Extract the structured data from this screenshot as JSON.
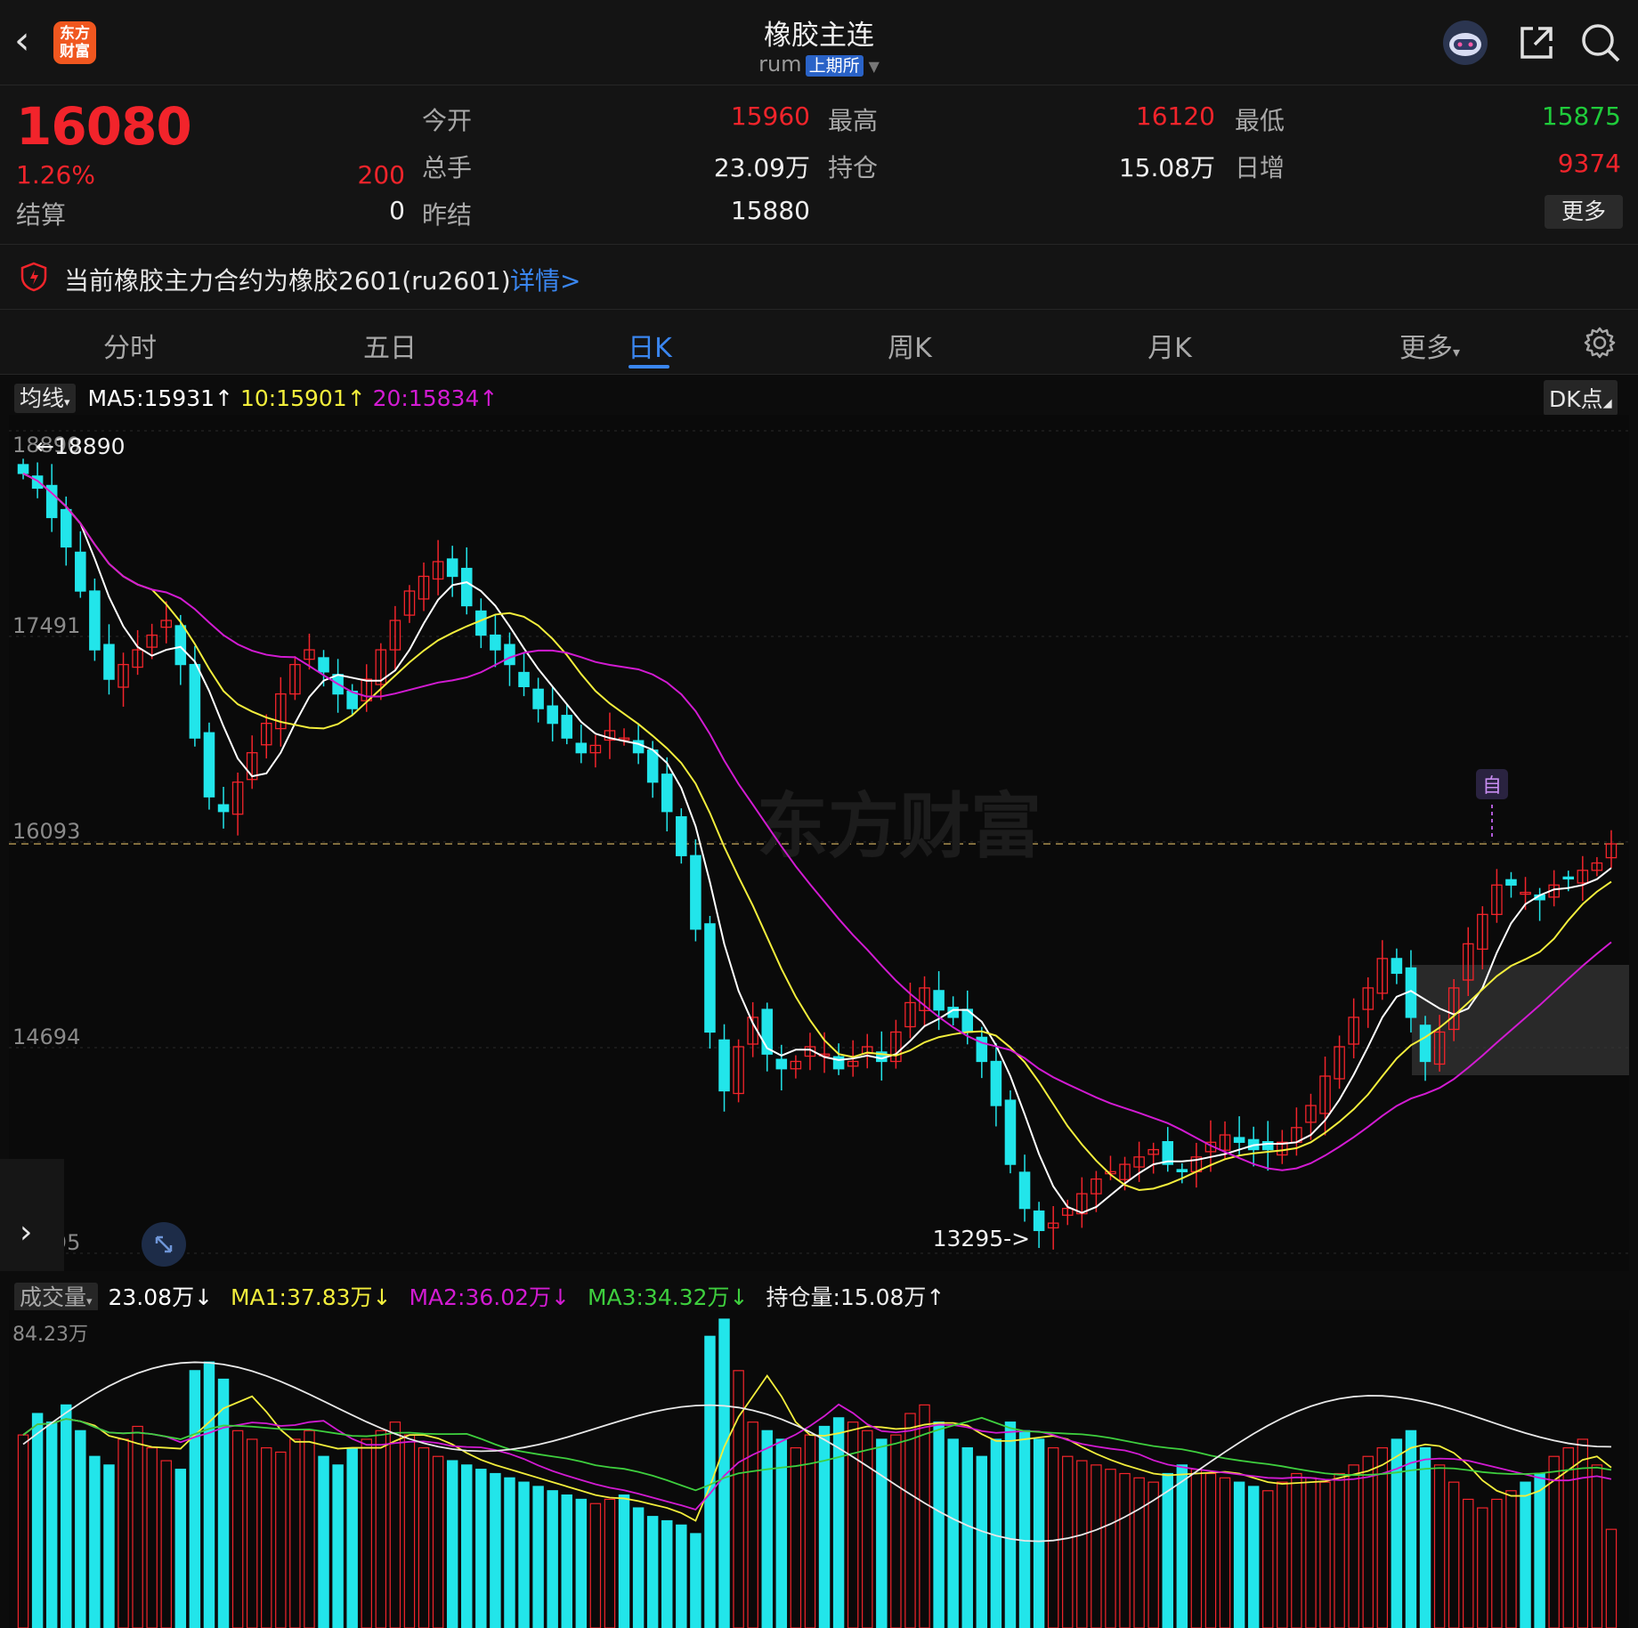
{
  "header": {
    "logo_text_1": "东方",
    "logo_text_2": "财富",
    "title": "橡胶主连",
    "code": "rum",
    "exchange": "上期所",
    "icons": [
      "back-icon",
      "robot-icon",
      "share-icon",
      "search-icon"
    ]
  },
  "quote": {
    "last": "16080",
    "change_pct": "1.26%",
    "change": "200",
    "open_label": "今开",
    "open": "15960",
    "high_label": "最高",
    "high": "16120",
    "low_label": "最低",
    "low": "15875",
    "volume_label": "总手",
    "volume": "23.09万",
    "oi_label": "持仓",
    "oi": "15.08万",
    "daily_add_label": "日增",
    "daily_add": "9374",
    "settle_label": "结算",
    "settle": "0",
    "prev_settle_label": "昨结",
    "prev_settle": "15880",
    "more_label": "更多"
  },
  "notice": {
    "text": "当前橡胶主力合约为橡胶2601(ru2601)",
    "link": "详情>"
  },
  "tabs": [
    {
      "label": "分时"
    },
    {
      "label": "五日"
    },
    {
      "label": "日K"
    },
    {
      "label": "周K"
    },
    {
      "label": "月K"
    },
    {
      "label": "更多"
    }
  ],
  "indicators": {
    "ma_selector": "均线",
    "ma5": "MA5:15931↑",
    "ma10": "10:15901↑",
    "ma20": "20:15834↑",
    "dk": "DK点",
    "vol_selector": "成交量",
    "vol": "23.08万↓",
    "vol_ma1": "MA1:37.83万↓",
    "vol_ma2": "MA2:36.02万↓",
    "vol_ma3": "MA3:34.32万↓",
    "oi": "持仓量:15.08万↑"
  },
  "colors": {
    "up": "#f2242b",
    "down": "#22e5ea",
    "ma5": "#ffffff",
    "ma10": "#f3ee3c",
    "ma20": "#d21bd2",
    "accent": "#3a86f0",
    "vol_ma3": "#3ecf3e"
  },
  "chart_data": {
    "type": "candlestick",
    "y_ticks": [
      "18890",
      "17491",
      "16093",
      "14694",
      "13295"
    ],
    "ylim": [
      13295,
      18890
    ],
    "high_label": "18890",
    "low_label": "13295->",
    "last_price": 16080,
    "marker_label": "自",
    "closes": [
      18600,
      18500,
      18300,
      18100,
      17800,
      17400,
      17200,
      17300,
      17400,
      17500,
      17600,
      17300,
      16800,
      16400,
      16300,
      16500,
      16700,
      16900,
      17100,
      17300,
      17400,
      17250,
      17100,
      17000,
      17200,
      17400,
      17600,
      17800,
      17900,
      18000,
      17900,
      17700,
      17500,
      17400,
      17300,
      17150,
      17000,
      16900,
      16800,
      16700,
      16750,
      16850,
      16800,
      16700,
      16500,
      16300,
      16000,
      15500,
      14800,
      14400,
      14700,
      14900,
      14650,
      14550,
      14600,
      14700,
      14650,
      14550,
      14600,
      14700,
      14600,
      14800,
      15000,
      15100,
      14950,
      14900,
      14800,
      14600,
      14300,
      13900,
      13600,
      13450,
      13500,
      13600,
      13700,
      13800,
      13850,
      13900,
      13950,
      14000,
      13900,
      13850,
      13950,
      14050,
      14100,
      14050,
      14000,
      14000,
      14050,
      14150,
      14300,
      14500,
      14700,
      14900,
      15100,
      15300,
      15200,
      14900,
      14600,
      14800,
      15100,
      15400,
      15600,
      15800,
      15800,
      15750,
      15700,
      15800,
      15850,
      15900,
      15950,
      16080
    ],
    "volume_axis_label": "84.23万",
    "volume": [
      45,
      50,
      48,
      52,
      46,
      40,
      38,
      44,
      47,
      42,
      39,
      37,
      60,
      62,
      58,
      46,
      44,
      42,
      41,
      44,
      46,
      40,
      38,
      42,
      44,
      46,
      48,
      45,
      42,
      40,
      39,
      38,
      37,
      36,
      35,
      34,
      33,
      32,
      31,
      30,
      29,
      30,
      31,
      28,
      26,
      25,
      24,
      22,
      68,
      72,
      60,
      48,
      46,
      44,
      42,
      45,
      47,
      49,
      48,
      46,
      44,
      45,
      50,
      52,
      48,
      44,
      42,
      40,
      44,
      48,
      46,
      44,
      42,
      40,
      39,
      38,
      37,
      36,
      35,
      34,
      36,
      38,
      37,
      36,
      35,
      34,
      33,
      32,
      34,
      36,
      35,
      34,
      36,
      38,
      40,
      42,
      44,
      46,
      42,
      38,
      34,
      30,
      28,
      30,
      32,
      34,
      36,
      40,
      42,
      44,
      38,
      23
    ]
  }
}
